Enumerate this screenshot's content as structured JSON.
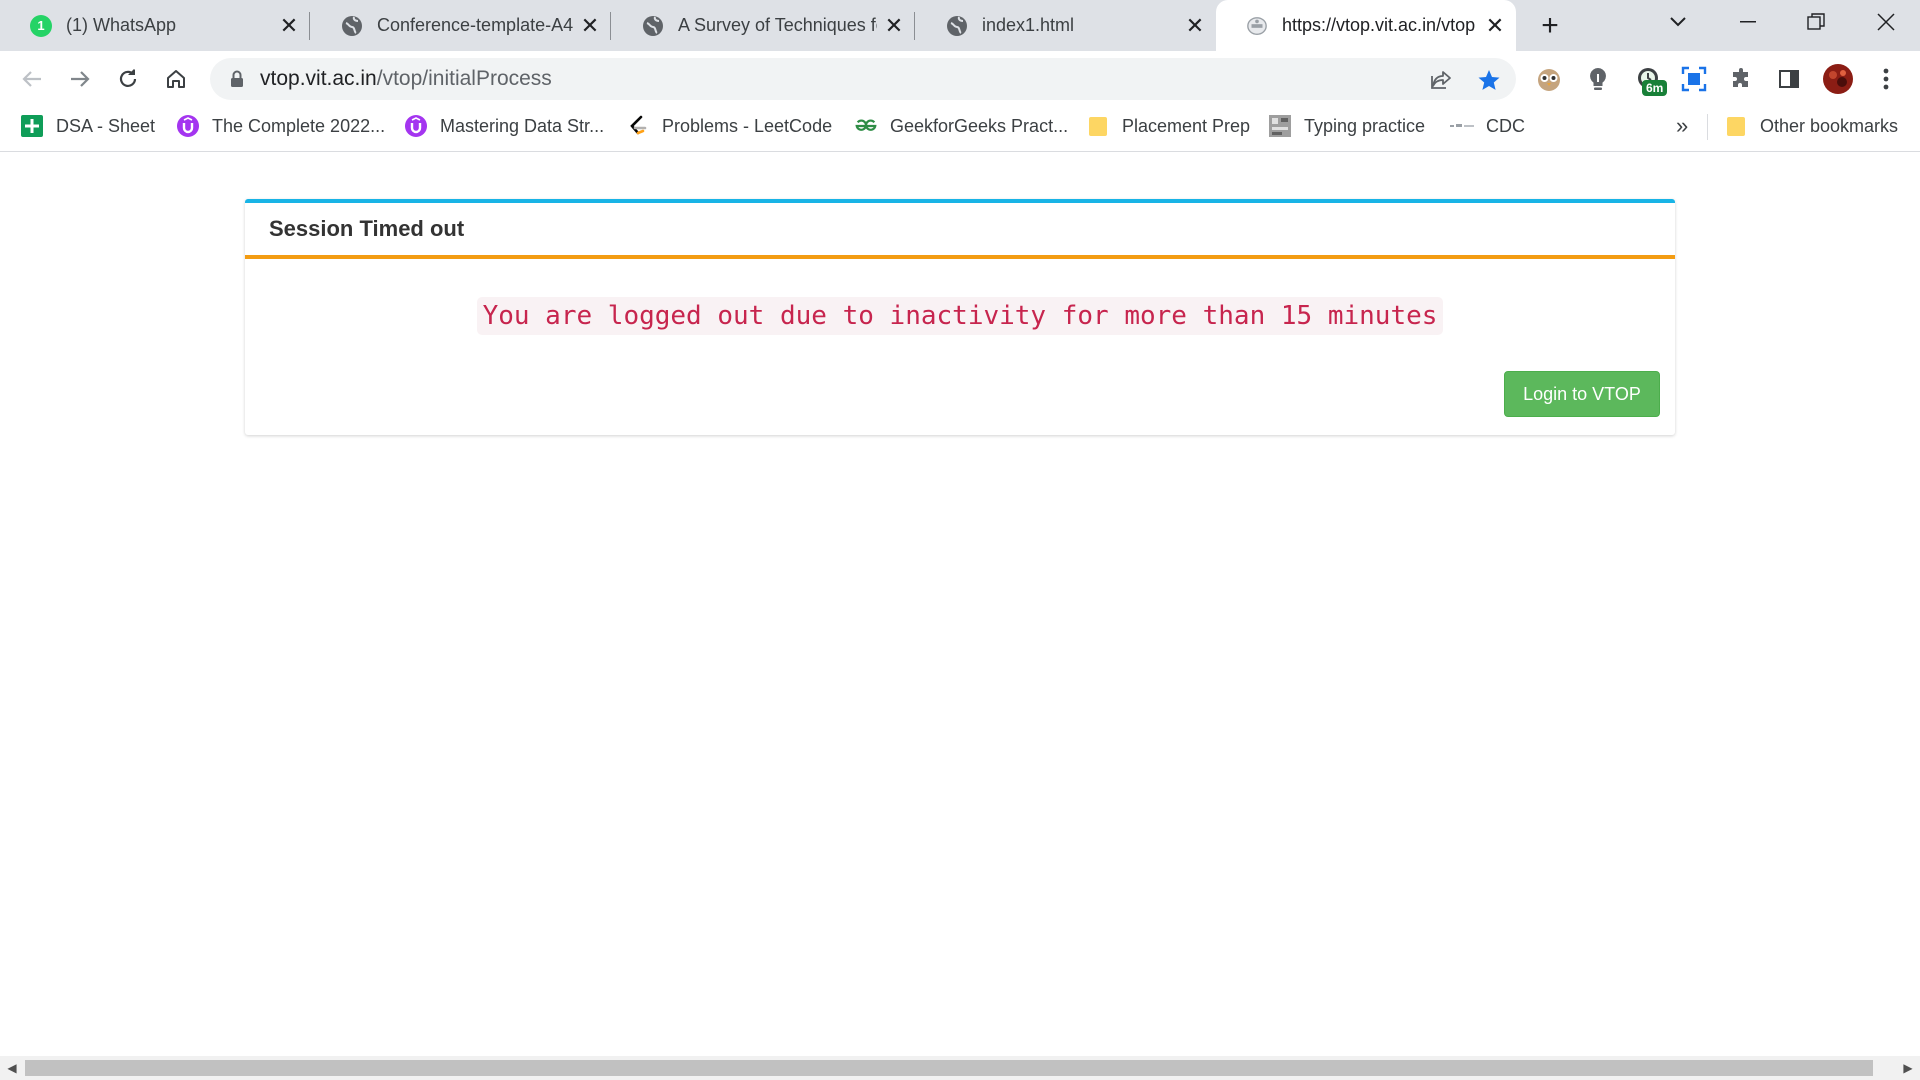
{
  "tabs": [
    {
      "title": "(1) WhatsApp",
      "favicon": "whatsapp-icon",
      "badge": "1",
      "active": false
    },
    {
      "title": "Conference-template-A4",
      "favicon": "globe-icon",
      "active": false
    },
    {
      "title": "A Survey of Techniques fo",
      "favicon": "globe-icon",
      "active": false
    },
    {
      "title": "index1.html",
      "favicon": "globe-icon",
      "active": false
    },
    {
      "title": "https://vtop.vit.ac.in/vtop",
      "favicon": "vit-logo-icon",
      "active": true
    }
  ],
  "toolbar": {
    "url_host": "vtop.vit.ac.in",
    "url_path": "/vtop/initialProcess",
    "timer_badge": "6m"
  },
  "bookmarks": [
    {
      "label": "DSA - Sheet",
      "icon": "sheets-icon"
    },
    {
      "label": "The Complete 2022...",
      "icon": "udemy-icon"
    },
    {
      "label": "Mastering Data Str...",
      "icon": "udemy-icon"
    },
    {
      "label": "Problems - LeetCode",
      "icon": "leetcode-icon"
    },
    {
      "label": "GeekforGeeks Pract...",
      "icon": "gfg-icon"
    },
    {
      "label": "Placement Prep",
      "icon": "folder-icon"
    },
    {
      "label": "Typing practice",
      "icon": "typing-icon"
    },
    {
      "label": "CDC",
      "icon": "cdc-icon"
    }
  ],
  "bookmarks_overflow": "»",
  "other_bookmarks": "Other bookmarks",
  "page": {
    "heading": "Session Timed out",
    "message": "You are logged out due to inactivity for more than 15 minutes",
    "login_button": "Login to VTOP"
  },
  "colors": {
    "panel_top_border": "#18b4e6",
    "heading_underline": "#f39c12",
    "message_text": "#c7254e",
    "message_bg": "#f9f2f4",
    "button_bg": "#5cb85c",
    "bookmark_star": "#1a73e8"
  }
}
